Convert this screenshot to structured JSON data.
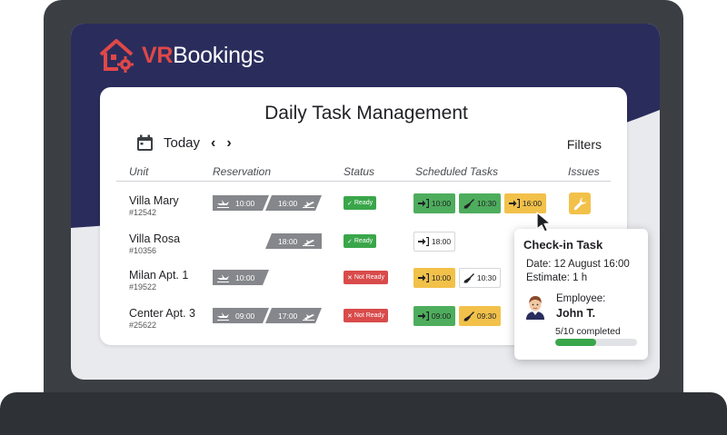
{
  "brand": {
    "logo_prefix": "VR",
    "logo_suffix": "Bookings",
    "color": "#e04848",
    "header_color": "#2a2d5c"
  },
  "page": {
    "title": "Daily Task Management",
    "date_label": "Today",
    "prev_symbol": "‹",
    "next_symbol": "›",
    "filters_label": "Filters"
  },
  "columns": [
    "Unit",
    "Reservation",
    "Status",
    "Scheduled Tasks",
    "Issues"
  ],
  "rows": [
    {
      "unit": "Villa Mary",
      "id": "#12542",
      "checkin": "10:00",
      "checkout": "16:00",
      "status": "Ready",
      "tasks": [
        {
          "icon": "check-in-icon",
          "time": "10:00",
          "color": "green"
        },
        {
          "icon": "broom-icon",
          "time": "10:30",
          "color": "green"
        },
        {
          "icon": "check-in-icon",
          "time": "16:00",
          "color": "yellow"
        }
      ],
      "issue_icon": "wrench-icon"
    },
    {
      "unit": "Villa Rosa",
      "id": "#10356",
      "checkout": "18:00",
      "status": "Ready",
      "tasks": [
        {
          "icon": "check-in-icon",
          "time": "18:00",
          "color": "white"
        }
      ]
    },
    {
      "unit": "Milan Apt. 1",
      "id": "#19522",
      "checkin": "10:00",
      "status": "Not Ready",
      "tasks": [
        {
          "icon": "check-in-icon",
          "time": "10:00",
          "color": "yellow"
        },
        {
          "icon": "broom-icon",
          "time": "10:30",
          "color": "white"
        }
      ]
    },
    {
      "unit": "Center Apt. 3",
      "id": "#25622",
      "checkin": "09:00",
      "checkout": "17:00",
      "status": "Not Ready",
      "tasks": [
        {
          "icon": "check-in-icon",
          "time": "09:00",
          "color": "green"
        },
        {
          "icon": "broom-icon",
          "time": "09:30",
          "color": "yellow"
        }
      ]
    }
  ],
  "popup": {
    "title": "Check-in Task",
    "date": "Date: 12 August 16:00",
    "estimate": "Estimate: 1 h",
    "employee_label": "Employee:",
    "employee_name": "John T.",
    "progress_text": "5/10 completed",
    "progress_fraction": 0.5
  }
}
